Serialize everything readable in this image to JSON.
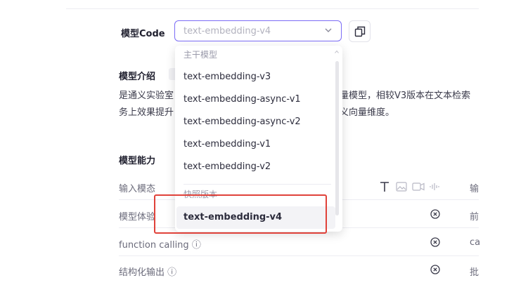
{
  "model_code": {
    "label": "模型Code",
    "select_value": "text-embedding-v4",
    "copy_icon": "copy-icon"
  },
  "dropdown": {
    "groups": [
      {
        "title": "主干模型",
        "options": [
          "text-embedding-v3",
          "text-embedding-async-v1",
          "text-embedding-async-v2",
          "text-embedding-v1",
          "text-embedding-v2"
        ]
      },
      {
        "title": "快照版本",
        "options": [
          "text-embedding-v4"
        ]
      }
    ],
    "selected": "text-embedding-v4"
  },
  "intro": {
    "title": "模型介绍",
    "line1_left": "是通义实验室",
    "line1_right": "量模型，相较V3版本在文本检索",
    "line2_left": "务上效果提升",
    "line2_right": "义向量维度。"
  },
  "capability": {
    "title": "模型能力",
    "rows": [
      {
        "label": "输入模态",
        "right": "输"
      },
      {
        "label": "模型体验",
        "right": "前"
      },
      {
        "label": "function calling",
        "info": "ⓘ",
        "right": "ca"
      },
      {
        "label": "结构化输出",
        "info": "ⓘ",
        "right": "批"
      }
    ]
  },
  "colors": {
    "accent": "#7b6cf6",
    "highlight": "#e0423a"
  }
}
